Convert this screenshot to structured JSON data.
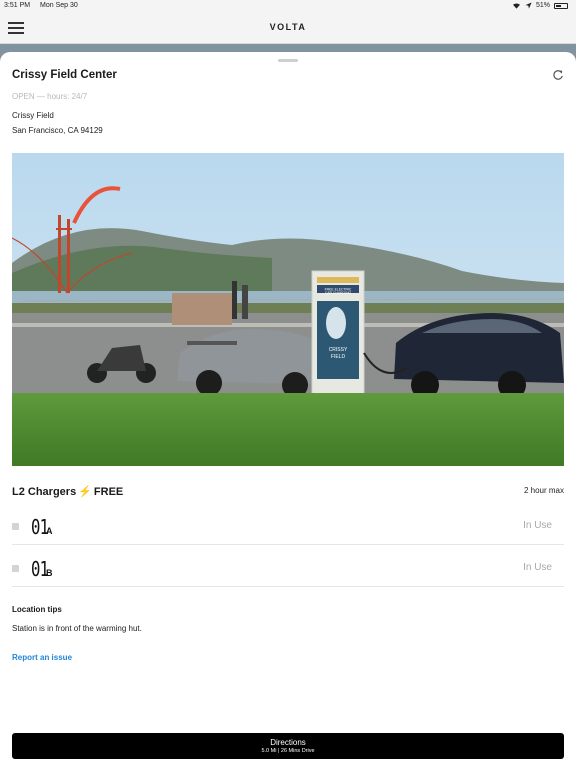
{
  "status_bar": {
    "time": "3:51 PM",
    "date": "Mon Sep 30",
    "battery": "51%",
    "battery_level": 0.51
  },
  "nav": {
    "brand": "VOLTA",
    "menu_icon": "hamburger-menu-icon"
  },
  "station": {
    "name": "Crissy Field Center",
    "hours": "OPEN — hours: 24/7",
    "address_line1": "Crissy Field",
    "address_line2": "San Francisco, CA 94129",
    "refresh_icon": "refresh-icon",
    "kiosk_lines": [
      "FREE ELECTRIC",
      "CAR CHARGING",
      "CRISSY",
      "FIELD"
    ]
  },
  "chargers": {
    "type_label": "L2 Chargers",
    "price": "FREE",
    "bolt_icon": "⚡",
    "max_time": "2 hour max",
    "units": [
      {
        "number": "01",
        "letter": "A",
        "status": "In Use"
      },
      {
        "number": "01",
        "letter": "B",
        "status": "In Use"
      }
    ]
  },
  "tips": {
    "label": "Location tips",
    "text": "Station is in front of the warming hut."
  },
  "report_link": "Report an issue",
  "directions": {
    "label": "Directions",
    "subtitle": "5.0 Mi | 26 Mins Drive"
  },
  "colors": {
    "accent_blue": "#1f86d8",
    "button_black": "#000000",
    "muted_gray": "#a8a8a8"
  }
}
